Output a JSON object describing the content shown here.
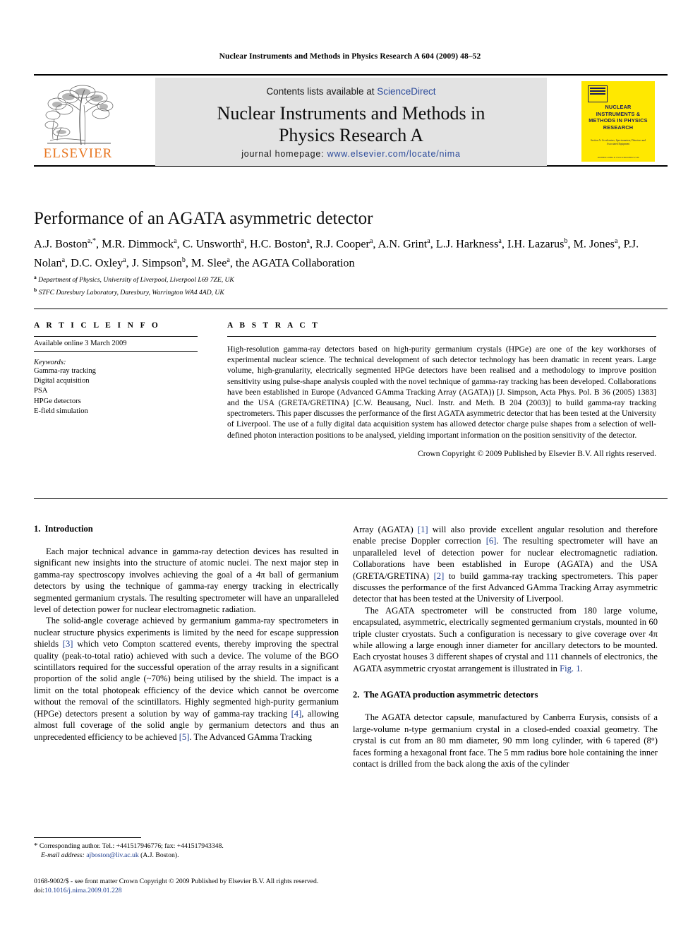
{
  "running_head": "Nuclear Instruments and Methods in Physics Research A 604 (2009) 48–52",
  "masthead": {
    "contents_prefix": "Contents lists available at ",
    "sciencedirect": "ScienceDirect",
    "journal_title_line1": "Nuclear Instruments and Methods in",
    "journal_title_line2": "Physics Research A",
    "homepage_prefix": "journal homepage: ",
    "homepage_url": "www.elsevier.com/locate/nima",
    "publisher_wordmark": "ELSEVIER",
    "cover": {
      "title": "NUCLEAR INSTRUMENTS & METHODS IN PHYSICS RESEARCH",
      "subtitle": "Section A: Accelerators, Spectrometers, Detectors and Associated Equipment",
      "footer": "Available online at www.sciencedirect.com"
    }
  },
  "colors": {
    "link_blue": "#2c4b9b",
    "citation_blue": "#1e3d8f",
    "elsevier_orange": "#E87722",
    "cover_yellow": "#FFE800",
    "banner_grey": "#e3e3e3"
  },
  "article": {
    "title": "Performance of an AGATA asymmetric detector",
    "authors": "A.J. Boston a,*, M.R. Dimmock a, C. Unsworth a, H.C. Boston a, R.J. Cooper a, A.N. Grint a, L.J. Harkness a, I.H. Lazarus b, M. Jones a, P.J. Nolan a, D.C. Oxley a, J. Simpson b, M. Slee a, the AGATA Collaboration",
    "affiliation_a": "Department of Physics, University of Liverpool, Liverpool L69 7ZE, UK",
    "affiliation_b": "STFC Daresbury Laboratory, Daresbury, Warrington WA4 4AD, UK"
  },
  "article_info": {
    "heading": "A R T I C L E  I N F O",
    "available_online": "Available online 3 March 2009",
    "keywords_label": "Keywords:",
    "keywords": [
      "Gamma-ray tracking",
      "Digital acquisition",
      "PSA",
      "HPGe detectors",
      "E-field simulation"
    ]
  },
  "abstract": {
    "heading": "A B S T R A C T",
    "text": "High-resolution gamma-ray detectors based on high-purity germanium crystals (HPGe) are one of the key workhorses of experimental nuclear science. The technical development of such detector technology has been dramatic in recent years. Large volume, high-granularity, electrically segmented HPGe detectors have been realised and a methodology to improve position sensitivity using pulse-shape analysis coupled with the novel technique of gamma-ray tracking has been developed. Collaborations have been established in Europe (Advanced GAmma Tracking Array (AGATA)) [J. Simpson, Acta Phys. Pol. B 36 (2005) 1383] and the USA (GRETA/GRETINA) [C.W. Beausang, Nucl. Instr. and Meth. B 204 (2003)] to build gamma-ray tracking spectrometers. This paper discusses the performance of the first AGATA asymmetric detector that has been tested at the University of Liverpool. The use of a fully digital data acquisition system has allowed detector charge pulse shapes from a selection of well-defined photon interaction positions to be analysed, yielding important information on the position sensitivity of the detector.",
    "copyright": "Crown Copyright © 2009 Published by Elsevier B.V. All rights reserved."
  },
  "sections": {
    "intro_heading_num": "1.",
    "intro_heading": "Introduction",
    "intro_p1": "Each major technical advance in gamma-ray detection devices has resulted in significant new insights into the structure of atomic nuclei. The next major step in gamma-ray spectroscopy involves achieving the goal of a 4π ball of germanium detectors by using the technique of gamma-ray energy tracking in electrically segmented germanium crystals. The resulting spectrometer will have an unparalleled level of detection power for nuclear electromagnetic radiation.",
    "intro_p2_a": "The solid-angle coverage achieved by germanium gamma-ray spectrometers in nuclear structure physics experiments is limited by the need for escape suppression shields ",
    "intro_p2_cite1": "[3]",
    "intro_p2_b": " which veto Compton scattered events, thereby improving the spectral quality (peak-to-total ratio) achieved with such a device. The volume of the BGO scintillators required for the successful operation of the array results in a significant proportion of the solid angle (~70%) being utilised by the shield. The impact is a limit on the total photopeak efficiency of the device which cannot be overcome without the removal of the scintillators. Highly segmented high-purity germanium (HPGe) detectors present a solution by way of gamma-ray tracking ",
    "intro_p2_cite2": "[4]",
    "intro_p2_c": ", allowing almost full coverage of the solid angle by germanium detectors and thus an unprecedented efficiency to be achieved ",
    "intro_p2_cite3": "[5]",
    "intro_p2_d": ". The Advanced GAmma Tracking",
    "right_p1_a": "Array (AGATA) ",
    "right_p1_cite1": "[1]",
    "right_p1_b": " will also provide excellent angular resolution and therefore enable precise Doppler correction ",
    "right_p1_cite2": "[6]",
    "right_p1_c": ". The resulting spectrometer will have an unparalleled level of detection power for nuclear electromagnetic radiation. Collaborations have been established in Europe (AGATA) and the USA (GRETA/GRETINA) ",
    "right_p1_cite3": "[2]",
    "right_p1_d": " to build gamma-ray tracking spectrometers. This paper discusses the performance of the first Advanced GAmma Tracking Array asymmetric detector that has been tested at the University of Liverpool.",
    "right_p2_a": "The AGATA spectrometer will be constructed from 180 large volume, encapsulated, asymmetric, electrically segmented germanium crystals, mounted in 60 triple cluster cryostats. Such a configuration is necessary to give coverage over 4π while allowing a large enough inner diameter for ancillary detectors to be mounted. Each cryostat houses 3 different shapes of crystal and 111 channels of electronics, the AGATA asymmetric cryostat arrangement is illustrated in ",
    "right_p2_figref": "Fig. 1",
    "right_p2_b": ".",
    "sec2_heading_num": "2.",
    "sec2_heading": "The AGATA production asymmetric detectors",
    "sec2_p1": "The AGATA detector capsule, manufactured by Canberra Eurysis, consists of a large-volume n-type germanium crystal in a closed-ended coaxial geometry. The crystal is cut from an 80 mm diameter, 90 mm long cylinder, with 6 tapered (8°) faces forming a hexagonal front face. The 5 mm radius bore hole containing the inner contact is drilled from the back along the axis of the cylinder"
  },
  "footnotes": {
    "corresponding": "Corresponding author. Tel.: +441517946776; fax: +441517943348.",
    "email_label": "E-mail address:",
    "email": "ajboston@liv.ac.uk",
    "email_suffix": "(A.J. Boston)."
  },
  "footer": {
    "issn_line": "0168-9002/$ - see front matter Crown Copyright © 2009 Published by Elsevier B.V. All rights reserved.",
    "doi_label": "doi:",
    "doi": "10.1016/j.nima.2009.01.228"
  }
}
